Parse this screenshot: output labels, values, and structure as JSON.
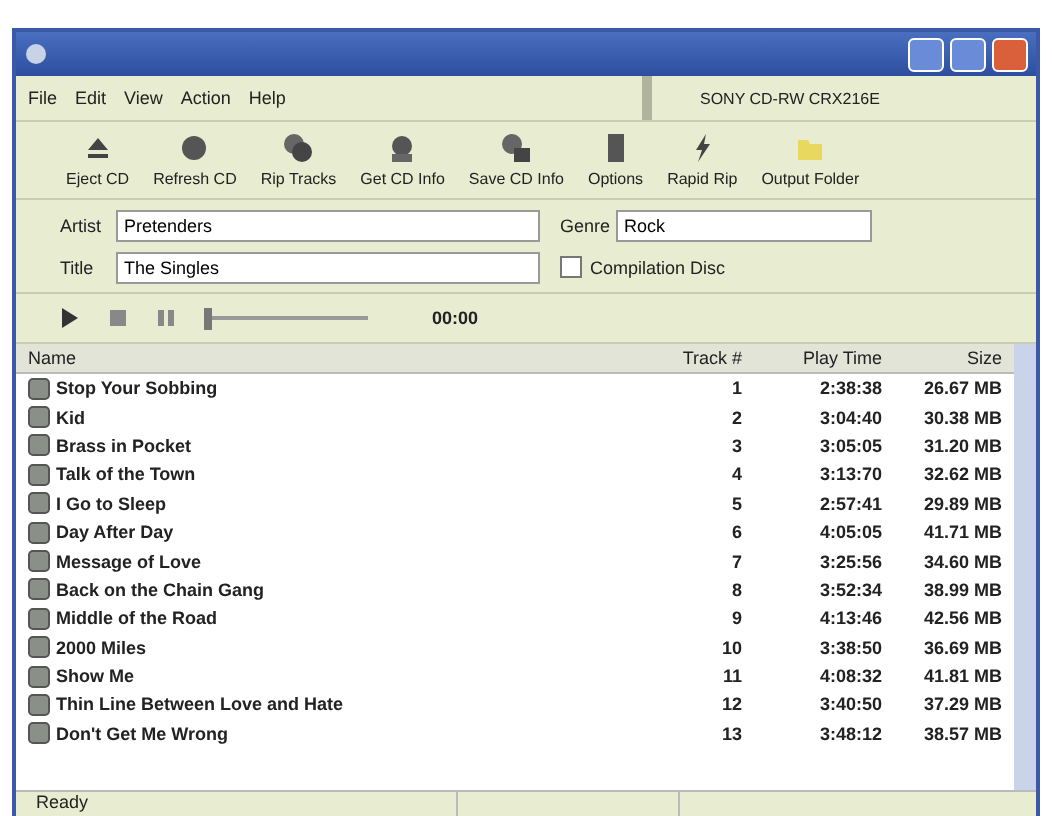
{
  "menu": [
    "File",
    "Edit",
    "View",
    "Action",
    "Help"
  ],
  "drive": "SONY CD-RW CRX216E",
  "toolbar": [
    {
      "label": "Eject CD",
      "kind": "eject"
    },
    {
      "label": "Refresh CD",
      "kind": "disc"
    },
    {
      "label": "Rip Tracks",
      "kind": "discs"
    },
    {
      "label": "Get CD Info",
      "kind": "info"
    },
    {
      "label": "Save CD Info",
      "kind": "save"
    },
    {
      "label": "Options",
      "kind": "options"
    },
    {
      "label": "Rapid Rip",
      "kind": "bolt"
    },
    {
      "label": "Output Folder",
      "kind": "folder"
    }
  ],
  "artist": {
    "label": "Artist",
    "value": "Pretenders"
  },
  "title": {
    "label": "Title",
    "value": "The Singles"
  },
  "genre": {
    "label": "Genre",
    "value": "Rock"
  },
  "compilation": {
    "label": "Compilation Disc",
    "checked": false
  },
  "player": {
    "time": "00:00",
    "level": 0.0
  },
  "columns": [
    "Name",
    "Track #",
    "Play Time",
    "Size"
  ],
  "rows": [
    {
      "name": "Stop Your Sobbing",
      "track": "1",
      "time": "2:38:38",
      "size": "26.67 MB"
    },
    {
      "name": "Kid",
      "track": "2",
      "time": "3:04:40",
      "size": "30.38 MB"
    },
    {
      "name": "Brass in Pocket",
      "track": "3",
      "time": "3:05:05",
      "size": "31.20 MB"
    },
    {
      "name": "Talk of the Town",
      "track": "4",
      "time": "3:13:70",
      "size": "32.62 MB"
    },
    {
      "name": "I Go to Sleep",
      "track": "5",
      "time": "2:57:41",
      "size": "29.89 MB"
    },
    {
      "name": "Day After Day",
      "track": "6",
      "time": "4:05:05",
      "size": "41.71 MB"
    },
    {
      "name": "Message of Love",
      "track": "7",
      "time": "3:25:56",
      "size": "34.60 MB"
    },
    {
      "name": "Back on the Chain Gang",
      "track": "8",
      "time": "3:52:34",
      "size": "38.99 MB"
    },
    {
      "name": "Middle of the Road",
      "track": "9",
      "time": "4:13:46",
      "size": "42.56 MB"
    },
    {
      "name": "2000 Miles",
      "track": "10",
      "time": "3:38:50",
      "size": "36.69 MB"
    },
    {
      "name": "Show Me",
      "track": "11",
      "time": "4:08:32",
      "size": "41.81 MB"
    },
    {
      "name": "Thin Line Between Love and Hate",
      "track": "12",
      "time": "3:40:50",
      "size": "37.29 MB"
    },
    {
      "name": "Don't Get Me Wrong",
      "track": "13",
      "time": "3:48:12",
      "size": "38.57 MB"
    }
  ],
  "status": "Ready"
}
